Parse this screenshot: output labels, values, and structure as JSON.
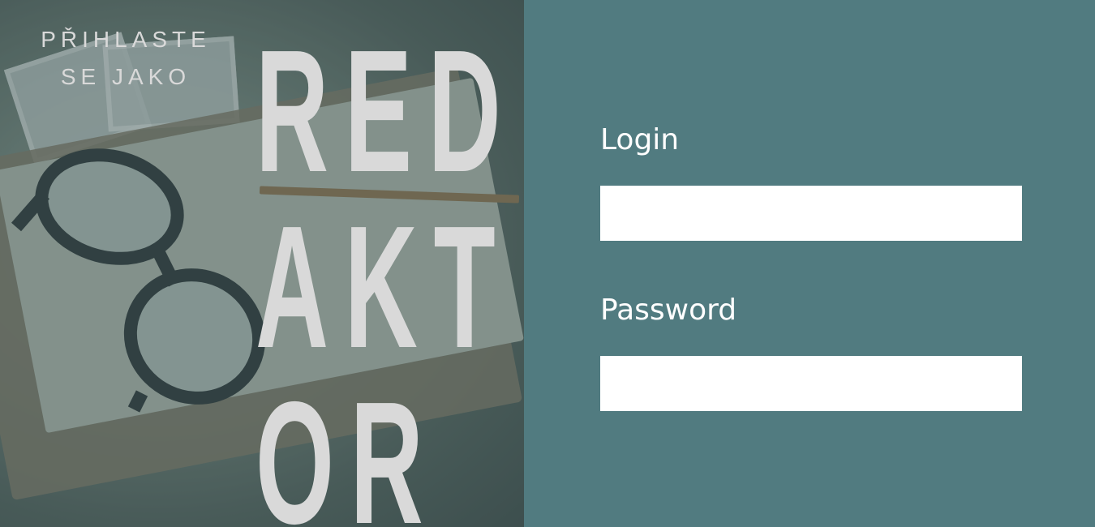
{
  "left_panel": {
    "subtitle_line1": "PŘIHLASTE",
    "subtitle_line2": "SE JAKO",
    "title_line1": "RED",
    "title_line2": "AKT",
    "title_line3": "OR"
  },
  "form": {
    "login_label": "Login",
    "login_value": "",
    "password_label": "Password",
    "password_value": ""
  },
  "colors": {
    "panel_background": "#517b80",
    "input_background": "#ffffff",
    "title_color": "#d9d9d9"
  }
}
